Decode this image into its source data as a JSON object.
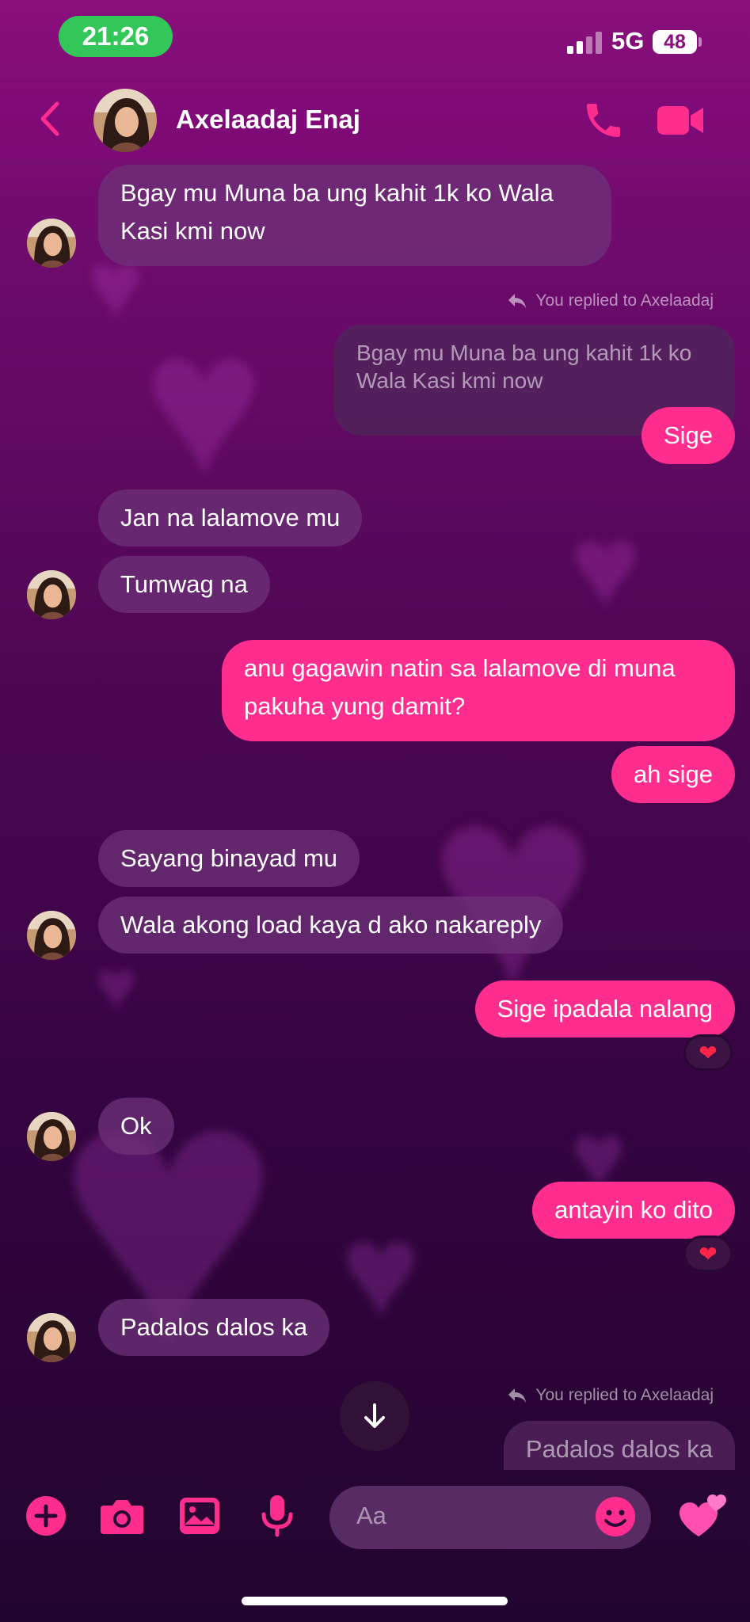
{
  "status_bar": {
    "time": "21:26",
    "network": "5G",
    "battery": "48"
  },
  "header": {
    "contact_name": "Axelaadaj Enaj"
  },
  "messages": {
    "m1": "Bgay mu Muna ba ung kahit 1k ko Wala Kasi kmi now",
    "reply1_label": "You replied to Axelaadaj",
    "reply1_quote": "Bgay mu Muna ba ung kahit 1k ko Wala Kasi kmi now",
    "m2": "Sige",
    "m3": "Jan na lalamove mu",
    "m4": "Tumwag na",
    "m5": "anu gagawin natin sa lalamove di muna pakuha yung damit?",
    "m6": "ah sige",
    "m7": "Sayang binayad mu",
    "m8": "Wala akong load kaya d ako nakareply",
    "m9": "Sige ipadala nalang",
    "m9_reaction": "❤",
    "m10": "Ok",
    "m11": "antayin ko dito",
    "m11_reaction": "❤",
    "m12": "Padalos dalos ka",
    "reply2_label": "You replied to Axelaadaj",
    "reply2_quote": "Padalos dalos ka"
  },
  "composer": {
    "placeholder": "Aa"
  },
  "icons": [
    "back-icon",
    "phone-icon",
    "video-camera-icon",
    "reply-arrow-icon",
    "arrow-down-icon",
    "plus-icon",
    "camera-icon",
    "image-icon",
    "microphone-icon",
    "emoji-icon",
    "hearts-icon"
  ],
  "colors": {
    "accent": "#ff2d8e",
    "status_green": "#33c759"
  }
}
